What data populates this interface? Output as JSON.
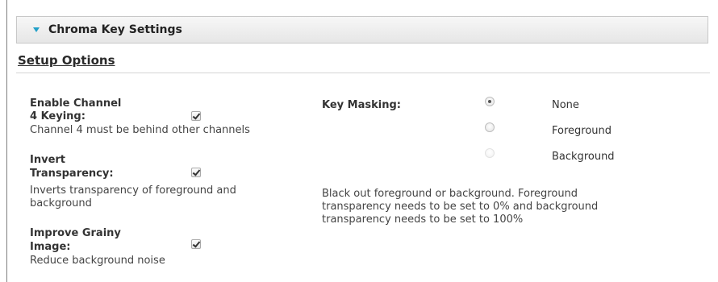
{
  "section": {
    "title": "Chroma Key Settings",
    "expanded": true,
    "toggle_icon": "triangle-down-icon",
    "accent_color": "#21a0c8"
  },
  "setup": {
    "heading": "Setup Options"
  },
  "options": {
    "channel4": {
      "label_line1": "Enable Channel",
      "label_line2": "4 Keying:",
      "checked": true,
      "description": "Channel 4 must be behind other channels"
    },
    "invert": {
      "label_line1": "Invert",
      "label_line2": "Transparency:",
      "checked": true,
      "description_line1": "Inverts transparency of foreground and",
      "description_line2": "background"
    },
    "grainy": {
      "label_line1": "Improve Grainy",
      "label_line2": "Image:",
      "checked": true,
      "description": "Reduce background noise"
    }
  },
  "key_masking": {
    "label": "Key Masking:",
    "options": [
      {
        "label": "None",
        "selected": true,
        "enabled": true
      },
      {
        "label": "Foreground",
        "selected": false,
        "enabled": true
      },
      {
        "label": "Background",
        "selected": false,
        "enabled": false
      }
    ],
    "description_line1": "Black out foreground or background. Foreground",
    "description_line2": "transparency needs to be set to 0% and background",
    "description_line3": "transparency needs to be set to 100%"
  }
}
